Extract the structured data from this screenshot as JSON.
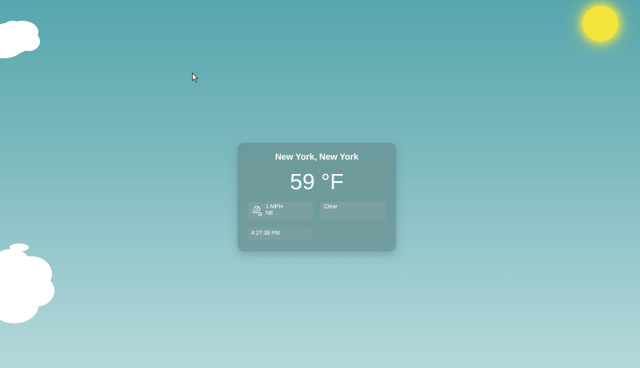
{
  "weather": {
    "location": "New York, New York",
    "temperature": "59 °F",
    "wind": {
      "speed": "1 MPH",
      "direction": "NE",
      "icon": "wind-icon"
    },
    "condition": "Clear",
    "time": "4:27:38 PM"
  },
  "scene": {
    "sun_color": "#f4e33a",
    "sky_top_color": "#57a6ad",
    "sky_bottom_color": "#b5d9db",
    "cloud_color": "#ffffff"
  }
}
